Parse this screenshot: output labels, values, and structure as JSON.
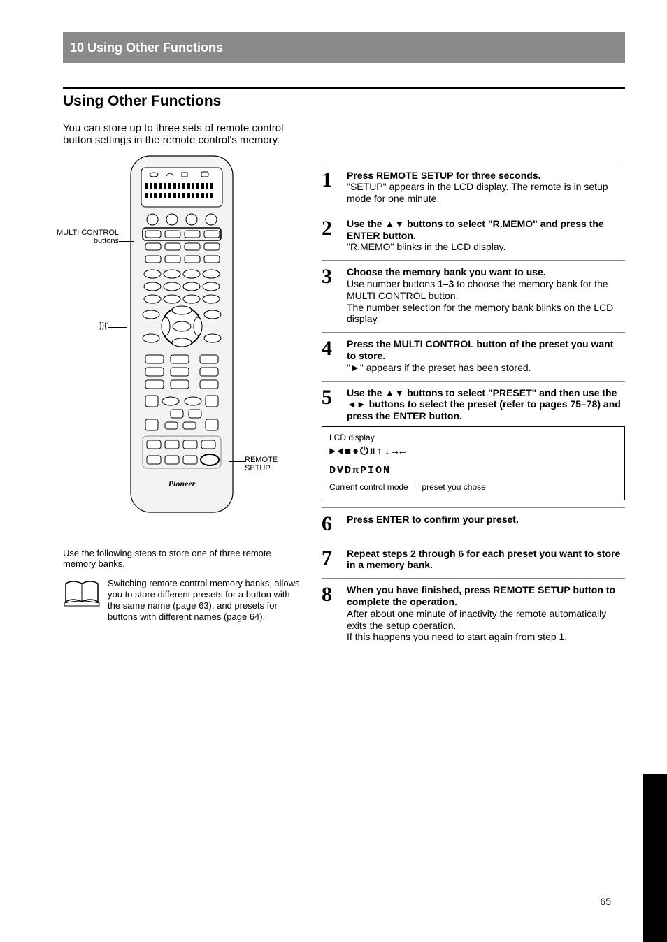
{
  "header": {
    "chapter_title": "10 Using Other Functions"
  },
  "section": {
    "title": "Using Other Functions"
  },
  "intro": "You can store up to three sets of remote control button settings in the remote control's memory.",
  "callouts": {
    "receiver_selectors": "MULTI CONTROL buttons",
    "arrows": "}]{‘",
    "remote_setup": "REMOTE SETUP"
  },
  "below_remote": "Use the following steps to store one of three remote memory banks.",
  "book_note": "Switching remote control memory banks, allows you to store different presets for a button with the same name (page 63), and presets for buttons with different names (page 64).",
  "steps": [
    {
      "num": "1",
      "head": "Press REMOTE SETUP for three seconds.",
      "body": "\"SETUP\" appears in the LCD display. The remote is in setup mode for one minute."
    },
    {
      "num": "2",
      "head_pre": "Use the ",
      "head_sym": "'/",
      "head_post": " buttons to select \"R.MEMO\" and press the ENTER button.",
      "body": "\"R.MEMO\" blinks in the LCD display."
    },
    {
      "num": "3",
      "head": "Choose the memory bank you want to use.",
      "body1_pre": "Use number buttons ",
      "body1_bold": "1–3",
      "body1_post": " to choose the memory bank for the MULTI CONTROL button.",
      "body2": "The number selection for the memory bank blinks on the LCD display."
    },
    {
      "num": "4",
      "head": "Press the MULTI CONTROL button of the preset you want to store.",
      "body_pre": "\"√\"",
      "body_post": " appears if the preset has been stored."
    },
    {
      "num": "5",
      "head_pre": "Use the ",
      "head_sym1": "'/",
      "head_post_a": " buttons to select \"PRESET\" and then use the ",
      "head_sym2": "|\\",
      "head_post_b": " buttons to select the preset (refer to pages 75–78) and press the ENTER button.",
      "body": ""
    },
    {
      "num": "6",
      "head": "Press ENTER to confirm your preset.",
      "body": ""
    },
    {
      "num": "7",
      "head": "Repeat steps 2 through 6 for each preset you want to store in a memory bank.",
      "body": ""
    },
    {
      "num": "8",
      "head": "When you have finished, press REMOTE SETUP button to complete the operation.",
      "body1": "After about one minute of inactivity the remote automatically exits the setup operation.",
      "body2": "If this happens you need to start again from step 1."
    }
  ],
  "displaybox": {
    "title": "LCD display",
    "line1_left": "√|",
    "line1_right": "~∫¡∏†∂…*",
    "line2": " DVDπPION",
    "caption_pre": "Current control mode ",
    "caption_post": " preset you chose"
  },
  "page_number": "65"
}
